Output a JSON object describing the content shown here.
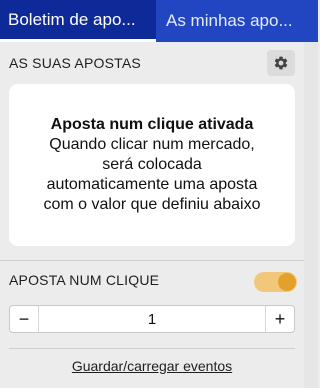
{
  "tabs": [
    {
      "label": "Boletim de apo...",
      "active": true
    },
    {
      "label": "As minhas apo...",
      "active": false
    }
  ],
  "section": {
    "title": "AS SUAS APOSTAS",
    "settings_icon": "gear-icon"
  },
  "info_card": {
    "title": "Aposta num clique ativada",
    "line1": "Quando clicar num mercado,",
    "line2": "será colocada",
    "line3": "automaticamente uma aposta",
    "line4": "com o valor que definiu abaixo"
  },
  "one_click": {
    "label": "APOSTA NUM CLIQUE",
    "enabled": true,
    "toggle_color": "#e3a12a"
  },
  "stepper": {
    "minus_label": "−",
    "value": "1",
    "plus_label": "+"
  },
  "footer": {
    "link_label": "Guardar/carregar eventos"
  },
  "colors": {
    "tab_active": "#0e2a99",
    "tab_inactive": "#2245c2",
    "panel_bg": "#ececec"
  }
}
